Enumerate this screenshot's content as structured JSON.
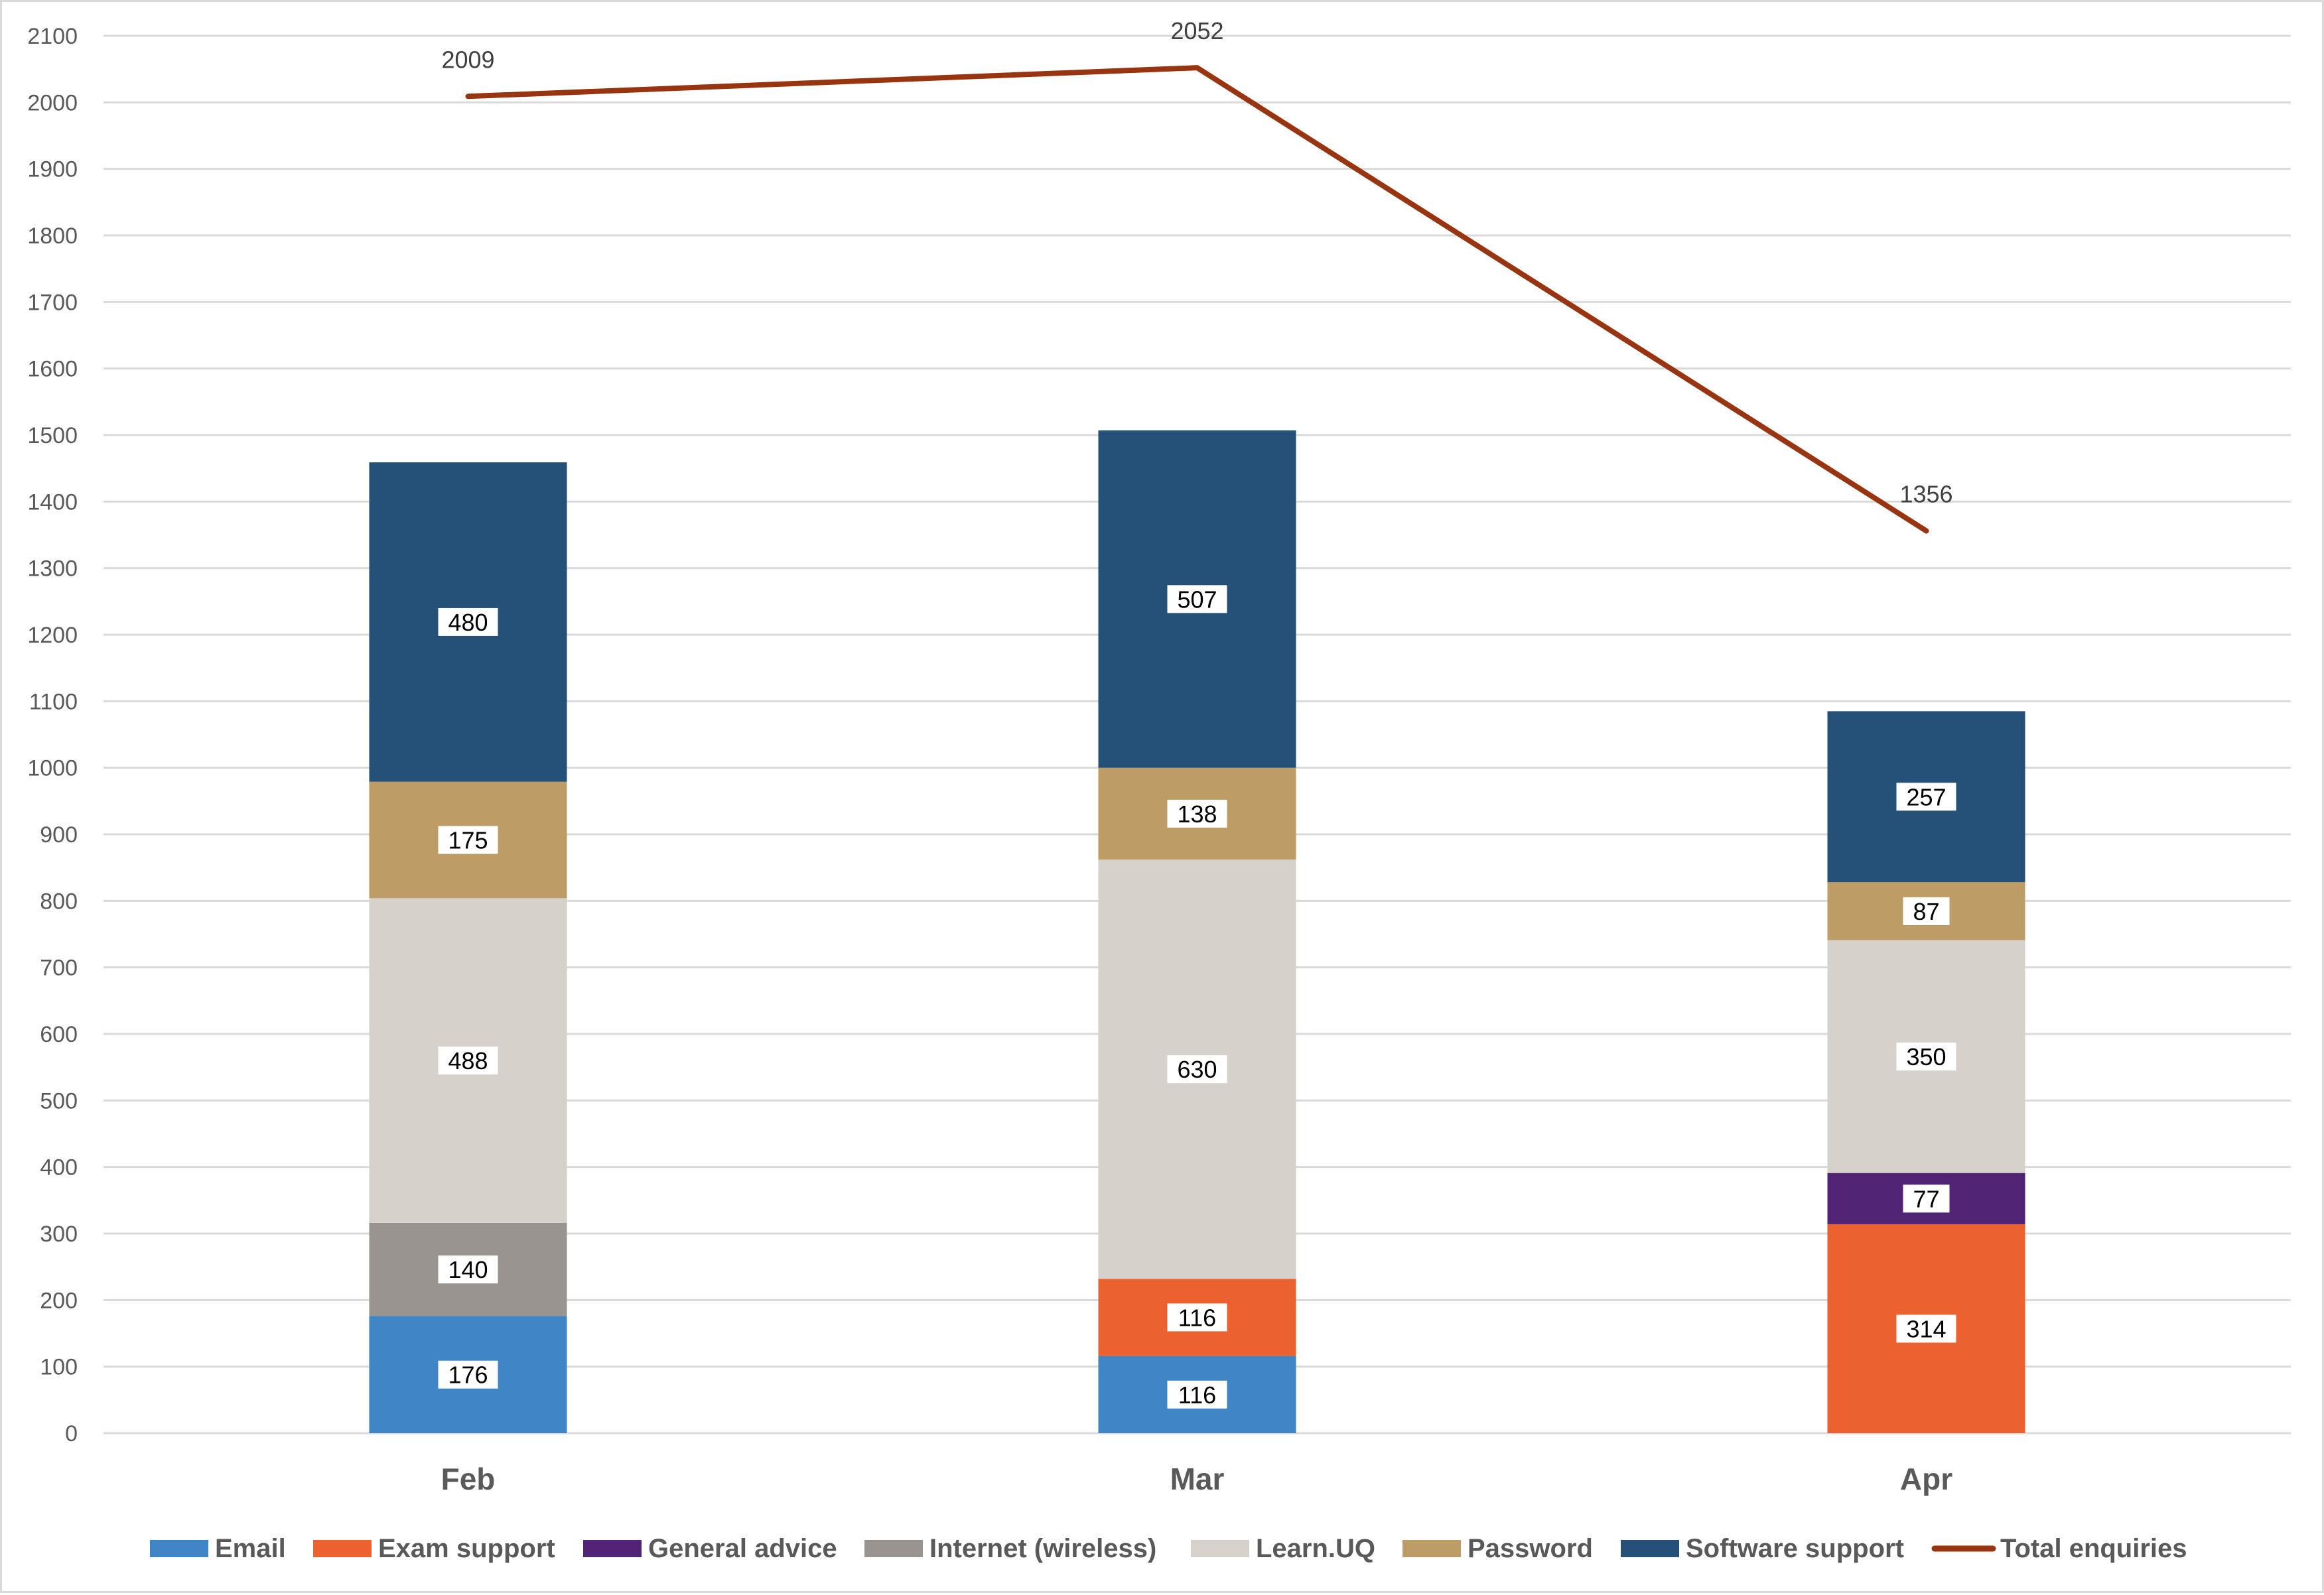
{
  "chart_data": {
    "type": "bar",
    "subtype": "stacked-bar-with-line",
    "title": "",
    "xlabel": "",
    "ylabel": "",
    "ylim": [
      0,
      2100
    ],
    "yticks": [
      0,
      100,
      200,
      300,
      400,
      500,
      600,
      700,
      800,
      900,
      1000,
      1100,
      1200,
      1300,
      1400,
      1500,
      1600,
      1700,
      1800,
      1900,
      2000,
      2100
    ],
    "grid": true,
    "legend_position": "bottom",
    "categories": [
      "Feb",
      "Mar",
      "Apr"
    ],
    "series": [
      {
        "name": "Email",
        "type": "bar",
        "color": "#4085C6",
        "values": [
          176,
          116,
          null
        ]
      },
      {
        "name": "Exam support",
        "type": "bar",
        "color": "#EB612F",
        "values": [
          null,
          116,
          314
        ]
      },
      {
        "name": "General advice",
        "type": "bar",
        "color": "#512476",
        "values": [
          null,
          null,
          77
        ]
      },
      {
        "name": "Internet (wireless)",
        "type": "bar",
        "color": "#99948F",
        "values": [
          140,
          null,
          null
        ]
      },
      {
        "name": "Learn.UQ",
        "type": "bar",
        "color": "#D6D2CB",
        "values": [
          488,
          630,
          350
        ]
      },
      {
        "name": "Password",
        "type": "bar",
        "color": "#BD9C66",
        "values": [
          175,
          138,
          87
        ]
      },
      {
        "name": "Software support",
        "type": "bar",
        "color": "#255179",
        "values": [
          480,
          507,
          257
        ]
      },
      {
        "name": "Total enquiries",
        "type": "line",
        "color": "#98340F",
        "values": [
          2009,
          2052,
          1356
        ]
      }
    ]
  }
}
